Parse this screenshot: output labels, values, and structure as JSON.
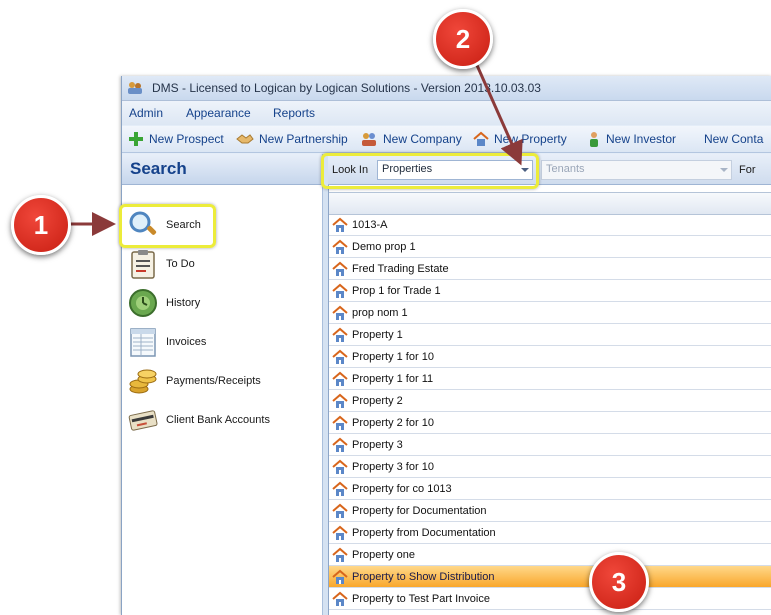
{
  "window": {
    "title": "DMS - Licensed to Logican by Logican Solutions - Version 2013.10.03.03"
  },
  "menu": [
    "Admin",
    "Appearance",
    "Reports"
  ],
  "toolbar": {
    "new_prospect": "New Prospect",
    "new_partnership": "New Partnership",
    "new_company": "New Company",
    "new_property": "New Property",
    "new_investor": "New Investor",
    "new_contact": "New Conta"
  },
  "left_pane": {
    "header": "Search",
    "items": [
      {
        "label": "Search",
        "icon": "magnifier-icon"
      },
      {
        "label": "To Do",
        "icon": "todo-clipboard-icon"
      },
      {
        "label": "History",
        "icon": "history-globe-icon"
      },
      {
        "label": "Invoices",
        "icon": "invoice-sheet-icon"
      },
      {
        "label": "Payments/Receipts",
        "icon": "coins-icon"
      },
      {
        "label": "Client Bank Accounts",
        "icon": "bank-card-icon"
      }
    ]
  },
  "search_bar": {
    "look_in_label": "Look In",
    "look_in_value": "Properties",
    "secondary_value": "Tenants",
    "for_label": "For"
  },
  "results": {
    "rows": [
      "1013-A",
      "Demo prop 1",
      "Fred Trading Estate",
      "Prop 1 for Trade 1",
      "prop nom 1",
      "Property 1",
      "Property 1 for 10",
      "Property 1 for 11",
      "Property 2",
      "Property 2 for 10",
      "Property 3",
      "Property 3 for 10",
      "Property for co 1013",
      "Property for Documentation",
      "Property from Documentation",
      "Property one",
      "Property to Show Distribution",
      "Property to Test Part Invoice"
    ],
    "selected_index": 16
  },
  "annotations": {
    "callouts": [
      "1",
      "2",
      "3"
    ],
    "highlight_color": "#ecec3a",
    "callout_color": "#d8281c",
    "arrow_color": "#8b3a3a"
  }
}
